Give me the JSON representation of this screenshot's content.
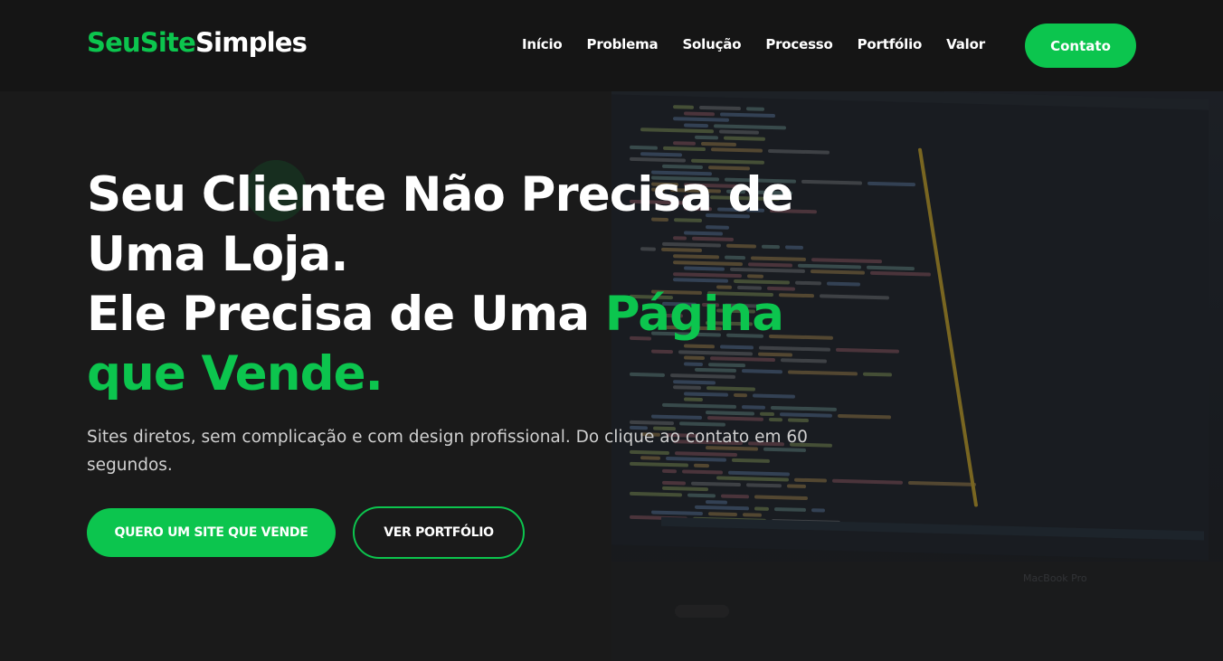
{
  "header": {
    "logo_accent": "SeuSite",
    "logo_rest": "Simples",
    "nav": [
      "Início",
      "Problema",
      "Solução",
      "Processo",
      "Portfólio",
      "Valor"
    ],
    "contact_label": "Contato"
  },
  "hero": {
    "title_line1": "Seu Cliente Não Precisa de",
    "title_line2": "Uma Loja.",
    "title_line3_prefix": "Ele Precisa de Uma",
    "title_line3_accent": "Página",
    "title_line4_accent": "que Vende.",
    "subtitle": "Sites diretos, sem complicação e com design profissional. Do clique ao contato em 60 segundos.",
    "primary_button": "QUERO UM SITE QUE VENDE",
    "secondary_button": "VER PORTFÓLIO"
  },
  "background": {
    "brand_text": "MacBook Pro"
  },
  "colors": {
    "accent": "#0cc54e",
    "background": "#1a1a1a",
    "header": "#151515",
    "text": "#ffffff"
  }
}
